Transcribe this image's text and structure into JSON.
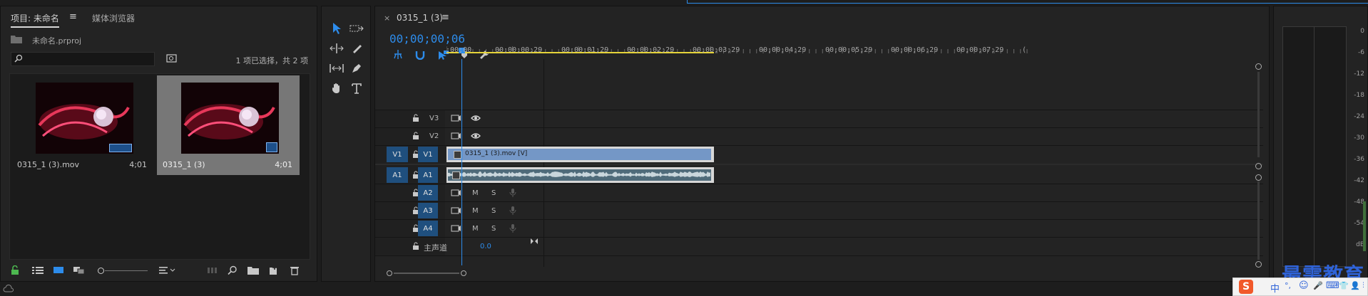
{
  "project_panel": {
    "tab_project": "项目: 未命名",
    "tab_menu": "≡",
    "tab_media_browser": "媒体浏览器",
    "project_file": "未命名.prproj",
    "selection_status": "1 项已选择，共 2 项",
    "search_placeholder": "",
    "items": [
      {
        "name": "0315_1 (3).mov",
        "duration": "4;01",
        "selected": false
      },
      {
        "name": "0315_1 (3)",
        "duration": "4;01",
        "selected": true
      }
    ]
  },
  "tools": [
    "selection-tool",
    "track-select-tool",
    "ripple-edit-tool",
    "razor-tool",
    "slip-tool",
    "pen-tool",
    "hand-tool",
    "type-tool"
  ],
  "timeline": {
    "close_symbol": "×",
    "sequence_tab": "0315_1 (3)",
    "tab_menu": "≡",
    "timecode": "00;00;00;06",
    "ruler_labels": [
      ";00;00",
      "00;00;00;29",
      "00;00;01;29",
      "00;00;02;29",
      "00;00;03;29",
      "00;00;04;29",
      "00;00;05;29",
      "00;00;06;29",
      "00;00;07;29",
      "("
    ],
    "video_tracks": [
      {
        "label": "V3",
        "source": ""
      },
      {
        "label": "V2",
        "source": ""
      },
      {
        "label": "V1",
        "source": "V1"
      }
    ],
    "audio_tracks": [
      {
        "label": "A1",
        "source": "A1"
      },
      {
        "label": "A2",
        "source": ""
      },
      {
        "label": "A3",
        "source": ""
      },
      {
        "label": "A4",
        "source": ""
      }
    ],
    "mute_label": "M",
    "solo_label": "S",
    "master_label": "主声道",
    "master_value": "0.0",
    "video_clip_name": "0315_1 (3).mov [V]"
  },
  "meter": {
    "ticks": [
      "0",
      "-6",
      "-12",
      "-18",
      "-24",
      "-30",
      "-36",
      "-42",
      "-48",
      "-54",
      "dB"
    ]
  },
  "watermark": {
    "text": "最需教育",
    "ime_chars": [
      "中",
      "°,",
      "☺",
      "🎤",
      "⌨",
      "👕",
      "👤",
      "⋮⋮"
    ]
  },
  "colors": {
    "accent_blue": "#2d8ceb",
    "track_badge": "#1f4f7e",
    "video_clip": "#7497c6",
    "audio_clip": "#4f6b7a",
    "work_area": "#e6d43a",
    "lock_green": "#4db850"
  }
}
